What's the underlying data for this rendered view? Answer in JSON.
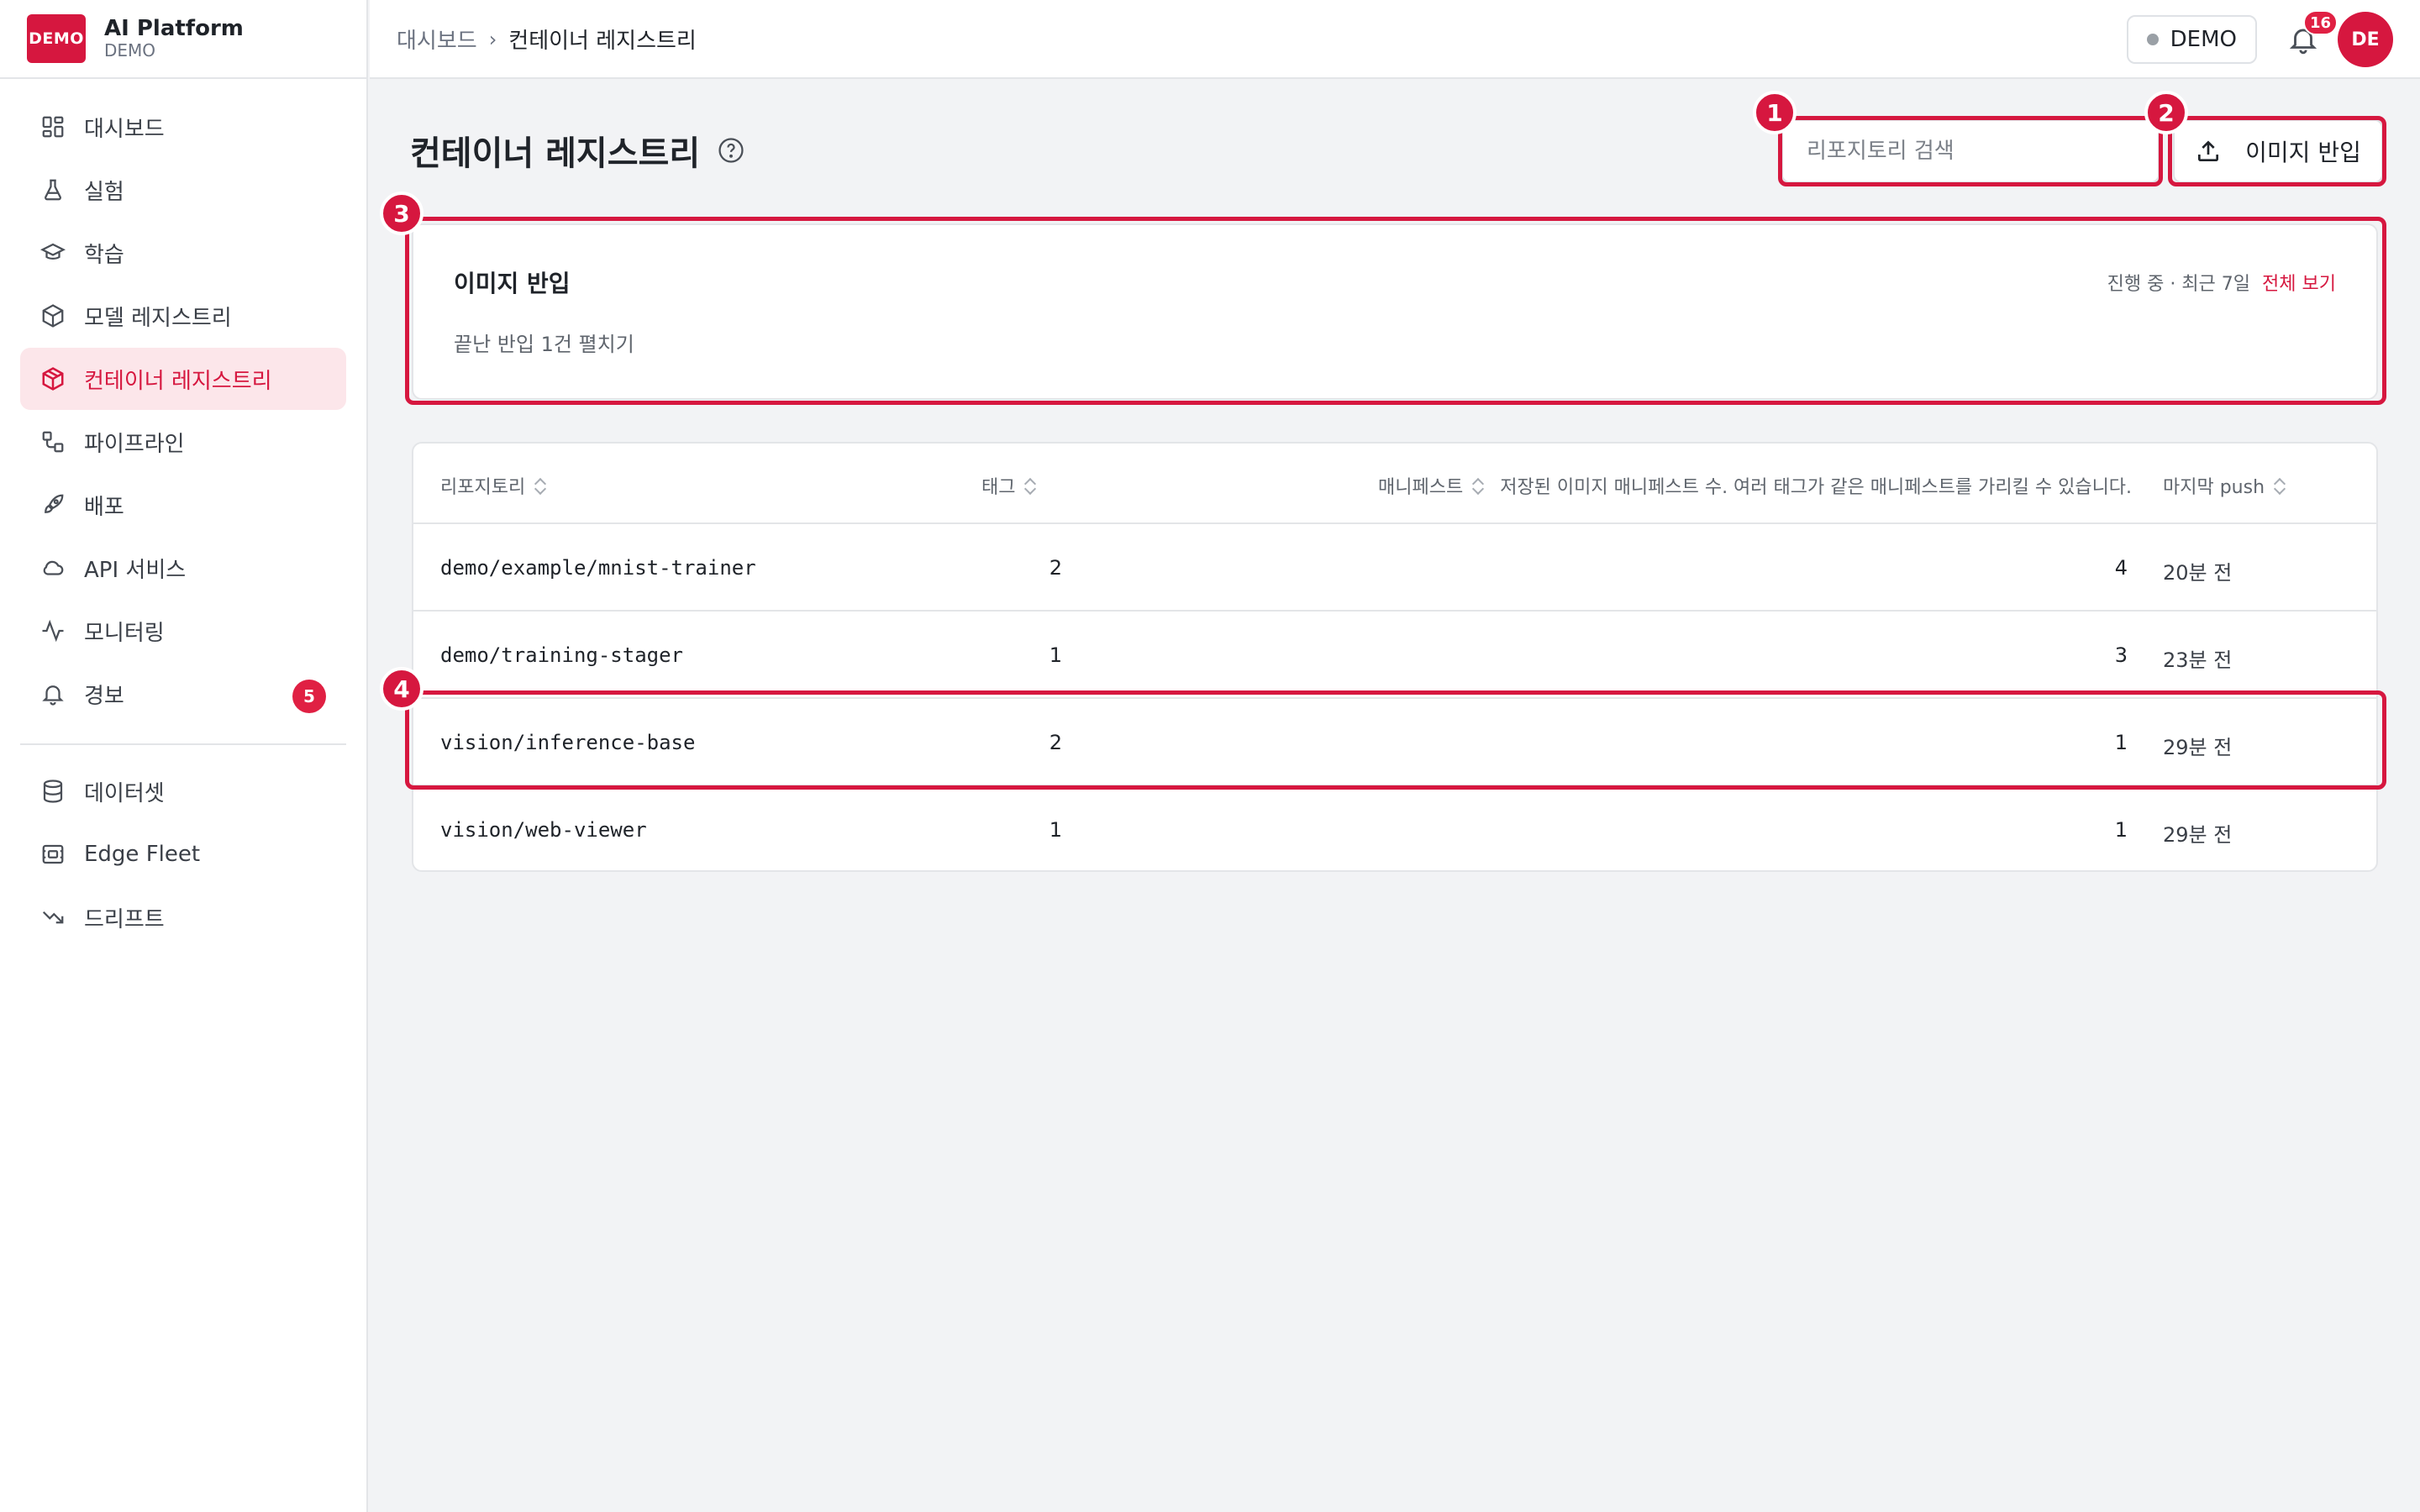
{
  "brand": {
    "logo": "DEMO",
    "name": "AI Platform",
    "env": "DEMO"
  },
  "sidebar": {
    "items": [
      {
        "label": "대시보드",
        "icon": "dashboard-icon"
      },
      {
        "label": "실험",
        "icon": "flask-icon"
      },
      {
        "label": "학습",
        "icon": "graduation-cap-icon"
      },
      {
        "label": "모델 레지스트리",
        "icon": "cube-icon"
      },
      {
        "label": "컨테이너 레지스트리",
        "icon": "container-icon",
        "active": true
      },
      {
        "label": "파이프라인",
        "icon": "pipeline-icon"
      },
      {
        "label": "배포",
        "icon": "rocket-icon"
      },
      {
        "label": "API 서비스",
        "icon": "cloud-icon"
      },
      {
        "label": "모니터링",
        "icon": "activity-icon"
      },
      {
        "label": "경보",
        "icon": "bell-icon",
        "badge": "5"
      }
    ],
    "secondary": [
      {
        "label": "데이터셋",
        "icon": "database-icon"
      },
      {
        "label": "Edge Fleet",
        "icon": "edge-device-icon"
      },
      {
        "label": "드리프트",
        "icon": "trending-down-icon"
      }
    ]
  },
  "topbar": {
    "breadcrumb": {
      "home": "대시보드",
      "current": "컨테이너 레지스트리"
    },
    "env_label": "DEMO",
    "notifications": "16",
    "avatar": "DE"
  },
  "page": {
    "title": "컨테이너 레지스트리",
    "search_placeholder": "리포지토리 검색",
    "import_button": "이미지 반입"
  },
  "import_card": {
    "title": "이미지 반입",
    "meta": "진행 중 · 최근 7일",
    "view_all": "전체 보기",
    "expand": "끝난 반입 1건 펼치기"
  },
  "table": {
    "headers": {
      "repository": "리포지토리",
      "tags": "태그",
      "manifests": "매니페스트",
      "manifests_hint": "저장된 이미지 매니페스트 수. 여러 태그가 같은 매니페스트를 가리킬 수 있습니다.",
      "last_push": "마지막 push"
    },
    "rows": [
      {
        "repo": "demo/example/mnist-trainer",
        "tags": "2",
        "manifests": "4",
        "last_push": "20분 전"
      },
      {
        "repo": "demo/training-stager",
        "tags": "1",
        "manifests": "3",
        "last_push": "23분 전"
      },
      {
        "repo": "vision/inference-base",
        "tags": "2",
        "manifests": "1",
        "last_push": "29분 전"
      },
      {
        "repo": "vision/web-viewer",
        "tags": "1",
        "manifests": "1",
        "last_push": "29분 전"
      }
    ]
  },
  "annotations": [
    "1",
    "2",
    "3",
    "4"
  ],
  "colors": {
    "accent": "#d6173f",
    "active_bg": "#fce6ea",
    "badge": "#e02043"
  }
}
